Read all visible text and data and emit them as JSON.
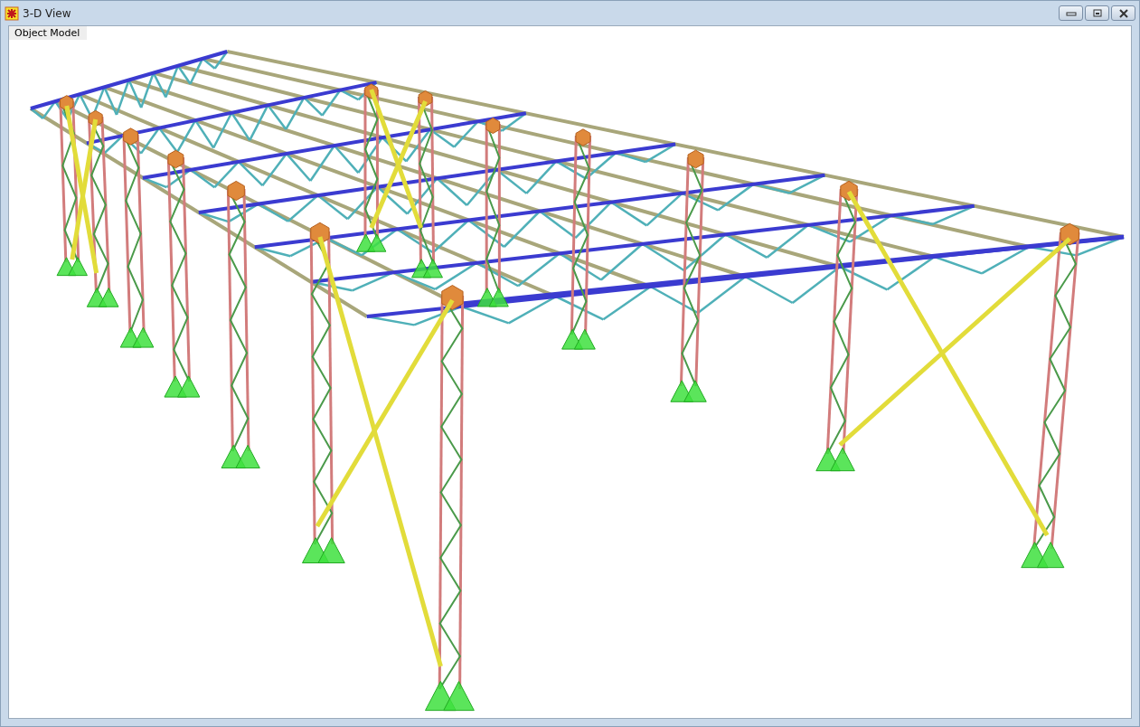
{
  "window": {
    "title": "3-D View"
  },
  "tab": {
    "label": "Object Model"
  }
}
